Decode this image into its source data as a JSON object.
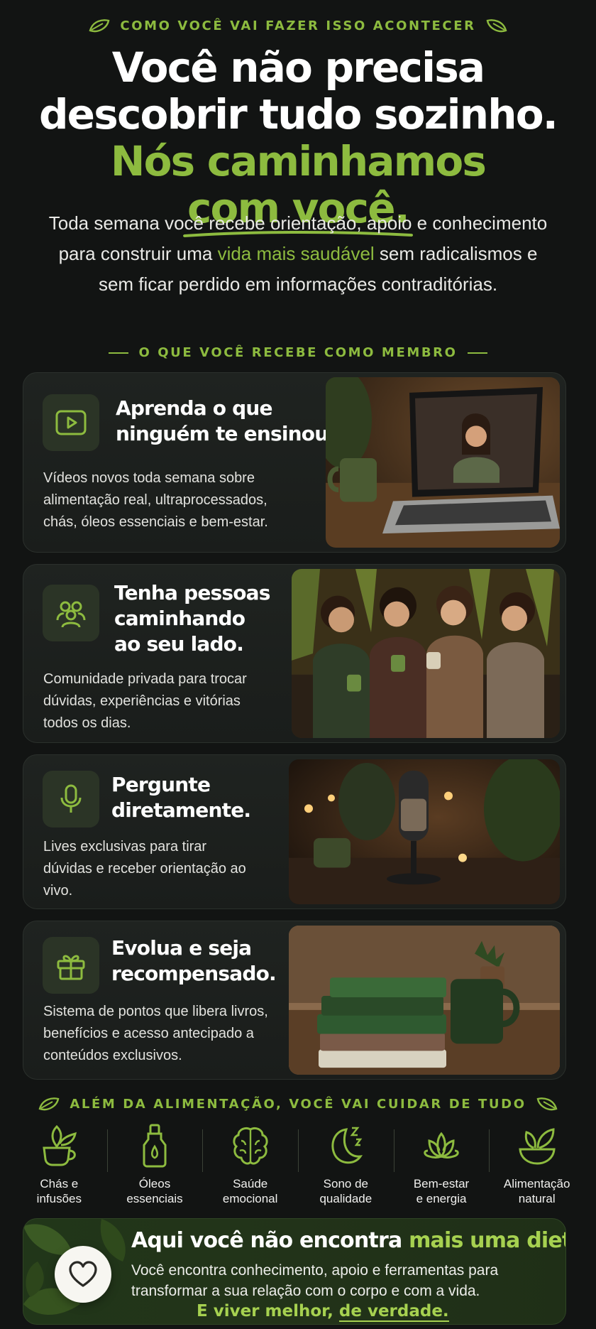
{
  "header": {
    "kicker": "COMO VOCÊ VAI FAZER ISSO ACONTECER",
    "headline_line1": "Você não precisa",
    "headline_line2": "descobrir tudo sozinho.",
    "headline_line3_a": "Nós caminhamos ",
    "headline_line3_b": "com você.",
    "lead_part1": "Toda semana você recebe orientação, apoio e conhecimento para construir uma ",
    "lead_highlight": "vida mais saudável",
    "lead_part2": " sem radicalismos e sem ficar perdido em informações contraditórias."
  },
  "members_section": {
    "title": "O QUE VOCÊ RECEBE COMO MEMBRO"
  },
  "cards": [
    {
      "icon": "play-video-icon",
      "title_l1": "Aprenda o que",
      "title_l2": "ninguém te ensinou.",
      "text": "Vídeos novos toda semana sobre alimentação real, ultraprocessados, chás, óleos essenciais e bem-estar."
    },
    {
      "icon": "community-users-icon",
      "title_l1": "Tenha pessoas",
      "title_l2": "caminhando",
      "title_l3": "ao seu lado.",
      "text": "Comunidade privada para trocar dúvidas, experiências e vitórias todos os dias."
    },
    {
      "icon": "microphone-icon",
      "title_l1": "Pergunte",
      "title_l2": "diretamente.",
      "text": "Lives exclusivas para tirar dúvidas e receber orientação ao vivo."
    },
    {
      "icon": "gift-icon",
      "title_l1": "Evolua e seja",
      "title_l2": "recompensado.",
      "text": "Sistema de pontos que libera livros, benefícios e acesso antecipado a conteúdos exclusivos."
    }
  ],
  "care_section": {
    "title": "ALÉM DA ALIMENTAÇÃO, VOCÊ VAI CUIDAR DE TUDO",
    "items": [
      {
        "icon": "tea-cup-icon",
        "l1": "Chás e",
        "l2": "infusões"
      },
      {
        "icon": "essential-oil-bottle-icon",
        "l1": "Óleos",
        "l2": "essenciais"
      },
      {
        "icon": "brain-icon",
        "l1": "Saúde",
        "l2": "emocional"
      },
      {
        "icon": "moon-sleep-icon",
        "l1": "Sono de",
        "l2": "qualidade"
      },
      {
        "icon": "lotus-icon",
        "l1": "Bem-estar",
        "l2": "e energia"
      },
      {
        "icon": "leaf-bowl-icon",
        "l1": "Alimentação",
        "l2": "natural"
      }
    ]
  },
  "banner": {
    "title_a": "Aqui você não encontra ",
    "title_b": "mais uma dieta.",
    "text": "Você encontra conhecimento, apoio e ferramentas para transformar a sua relação com o corpo e com a vida.",
    "tag_a": "E viver melhor, ",
    "tag_b": "de verdade."
  },
  "colors": {
    "accent": "#8dbb3f",
    "background": "#121413",
    "card": "#1f2320"
  }
}
